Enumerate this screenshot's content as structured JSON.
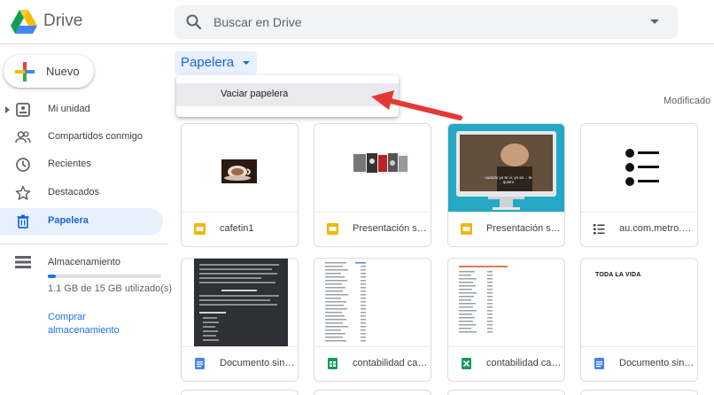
{
  "header": {
    "app_title": "Drive",
    "search_placeholder": "Buscar en Drive"
  },
  "sidebar": {
    "new_label": "Nuevo",
    "items": [
      {
        "label": "Mi unidad",
        "icon": "drive-icon",
        "active": false
      },
      {
        "label": "Compartidos conmigo",
        "icon": "people-icon",
        "active": false
      },
      {
        "label": "Recientes",
        "icon": "clock-icon",
        "active": false
      },
      {
        "label": "Destacados",
        "icon": "star-icon",
        "active": false
      },
      {
        "label": "Papelera",
        "icon": "trash-icon",
        "active": true
      }
    ],
    "storage": {
      "title": "Almacenamiento",
      "usage_text": "1.1 GB de 15 GB utilizado(s)",
      "used_fraction": 0.073,
      "buy_label": "Comprar almacenamiento"
    }
  },
  "main": {
    "breadcrumb": "Papelera",
    "menu": {
      "items": [
        "Vaciar papelera"
      ]
    },
    "sort_label": "Modificado",
    "files": [
      {
        "name": "cafetin1",
        "type_icon": "slides-icon",
        "thumb": "photo"
      },
      {
        "name": "Presentación sin título",
        "type_icon": "slides-icon",
        "thumb": "collage"
      },
      {
        "name": "Presentación sin título",
        "type_icon": "slides-icon",
        "thumb": "monitor",
        "thumb_caption": "cuando yo te vi, yo se… te quiero"
      },
      {
        "name": "au.com.metro.dumbways",
        "type_icon": "list-icon",
        "thumb": "list"
      },
      {
        "name": "Documento sin título",
        "type_icon": "docs-icon",
        "thumb": "dark-doc"
      },
      {
        "name": "contabilidad cafetin",
        "type_icon": "sheets-icon",
        "thumb": "sheet"
      },
      {
        "name": "contabilidad cafetin",
        "type_icon": "excel-icon",
        "thumb": "sheet-red"
      },
      {
        "name": "Documento sin título",
        "type_icon": "docs-icon",
        "thumb": "doc",
        "thumb_caption": "TODA LA VIDA"
      }
    ]
  },
  "colors": {
    "accent": "#1a73e8",
    "active_bg": "#e8f0fe",
    "slides": "#f4b400",
    "docs": "#4285f4",
    "sheets": "#0f9d58",
    "arrow": "#e53935"
  }
}
